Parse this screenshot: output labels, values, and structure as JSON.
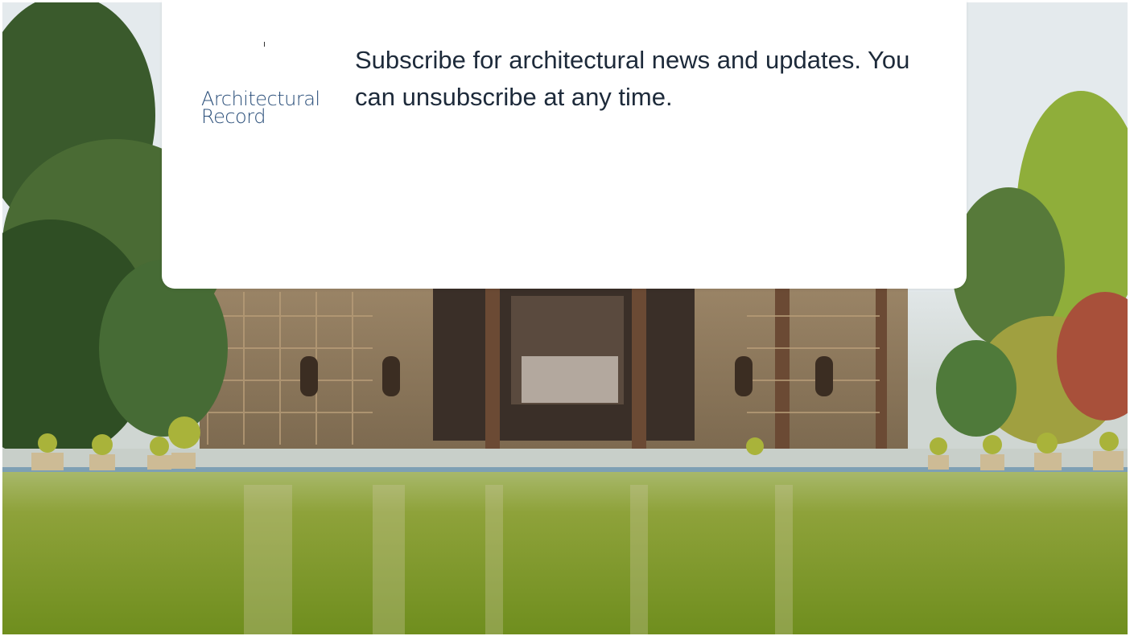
{
  "background": {
    "image": "Chehel Sotoun palace with reflecting pool and gardens",
    "colors": {
      "sky": "#e3e9ec",
      "water": "#7a9a2a",
      "foliage": "#3f5f2a",
      "building": "#8a7355"
    }
  },
  "popup": {
    "logo": {
      "line1": "Architectural",
      "line2": "Record",
      "color": "#2b4f7a"
    },
    "message": "Subscribe for architectural news and updates. You can unsubscribe at any time."
  }
}
